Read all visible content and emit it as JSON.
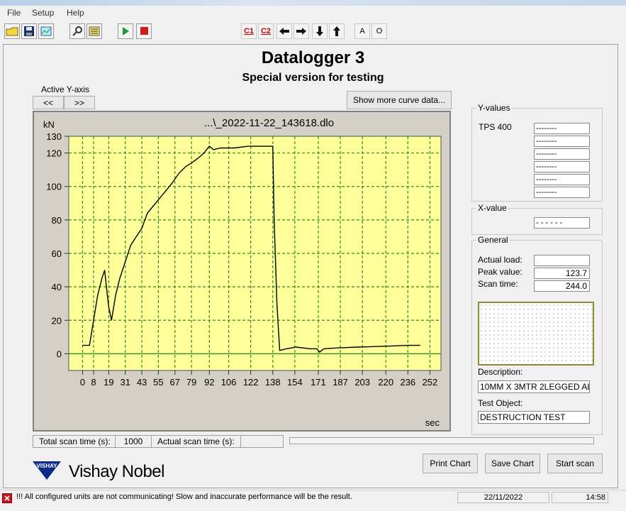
{
  "menu": {
    "file": "File",
    "setup": "Setup",
    "help": "Help"
  },
  "toolbar": {
    "c1_label": "C1",
    "c2_label": "C2",
    "a_label": "A",
    "o_label": "O"
  },
  "header": {
    "title": "Datalogger 3",
    "subtitle": "Special version for testing"
  },
  "active_y_axis": {
    "label": "Active Y-axis",
    "prev": "<<",
    "next": ">>"
  },
  "show_more_button": "Show more curve data...",
  "chart_data": {
    "type": "line",
    "title": "...\\_2022-11-22_143618.dlo",
    "ylabel": "kN",
    "xlabel": "sec",
    "ylim": [
      -10,
      130
    ],
    "xlim": [
      -10,
      260
    ],
    "yticks": [
      0,
      20,
      40,
      60,
      80,
      100,
      120,
      130
    ],
    "xticks": [
      0,
      8,
      19,
      31,
      43,
      55,
      67,
      79,
      92,
      106,
      122,
      138,
      154,
      171,
      187,
      203,
      220,
      236,
      252
    ],
    "plot_bg": "#ffff99",
    "line_color": "#000000",
    "grid_color": "#2e8b2e",
    "grid": true,
    "series": [
      {
        "x": [
          0,
          5,
          8,
          11,
          14,
          16,
          18,
          19,
          21,
          24,
          27,
          31,
          35,
          39,
          43,
          47,
          51,
          55,
          60,
          65,
          70,
          75,
          79,
          84,
          88,
          92,
          95,
          100,
          110,
          120,
          130,
          138,
          139,
          141,
          143,
          148,
          155,
          165,
          170,
          172,
          175,
          185,
          200,
          220,
          236,
          245
        ],
        "y": [
          5,
          5,
          20,
          35,
          45,
          50,
          35,
          28,
          20,
          35,
          45,
          55,
          65,
          70,
          75,
          84,
          88,
          92,
          97,
          102,
          108,
          112,
          114,
          117,
          120,
          124,
          122,
          123,
          123,
          124,
          124,
          124,
          80,
          30,
          2,
          3,
          4,
          3,
          3,
          1,
          3,
          3.5,
          4,
          4.5,
          5,
          5
        ]
      }
    ]
  },
  "y_values": {
    "title": "Y-values",
    "channel": "TPS 400",
    "values": [
      "--------",
      "--------",
      "--------",
      "--------",
      "--------",
      "--------"
    ]
  },
  "x_value": {
    "title": "X-value",
    "value": "- - - - - -"
  },
  "general": {
    "title": "General",
    "actual_load_label": "Actual load:",
    "actual_load": "",
    "peak_label": "Peak value:",
    "peak": "123.7",
    "scan_time_label": "Scan time:",
    "scan_time": "244.0",
    "description_label": "Description:",
    "description": "10MM X 3MTR 2LEGGED AL",
    "test_object_label": "Test Object:",
    "test_object": "DESTRUCTION TEST"
  },
  "scan_info": {
    "total_label": "Total scan time (s):",
    "total": "1000",
    "actual_label": "Actual scan time (s):",
    "actual": ""
  },
  "buttons": {
    "print": "Print Chart",
    "save": "Save Chart",
    "start": "Start scan"
  },
  "brand": {
    "vishay": "VISHAY",
    "name": "Vishay Nobel"
  },
  "status": {
    "message": "!!! All configured units are not communicating! Slow and inaccurate performance will be the result.",
    "date": "22/11/2022",
    "time": "14:58"
  }
}
